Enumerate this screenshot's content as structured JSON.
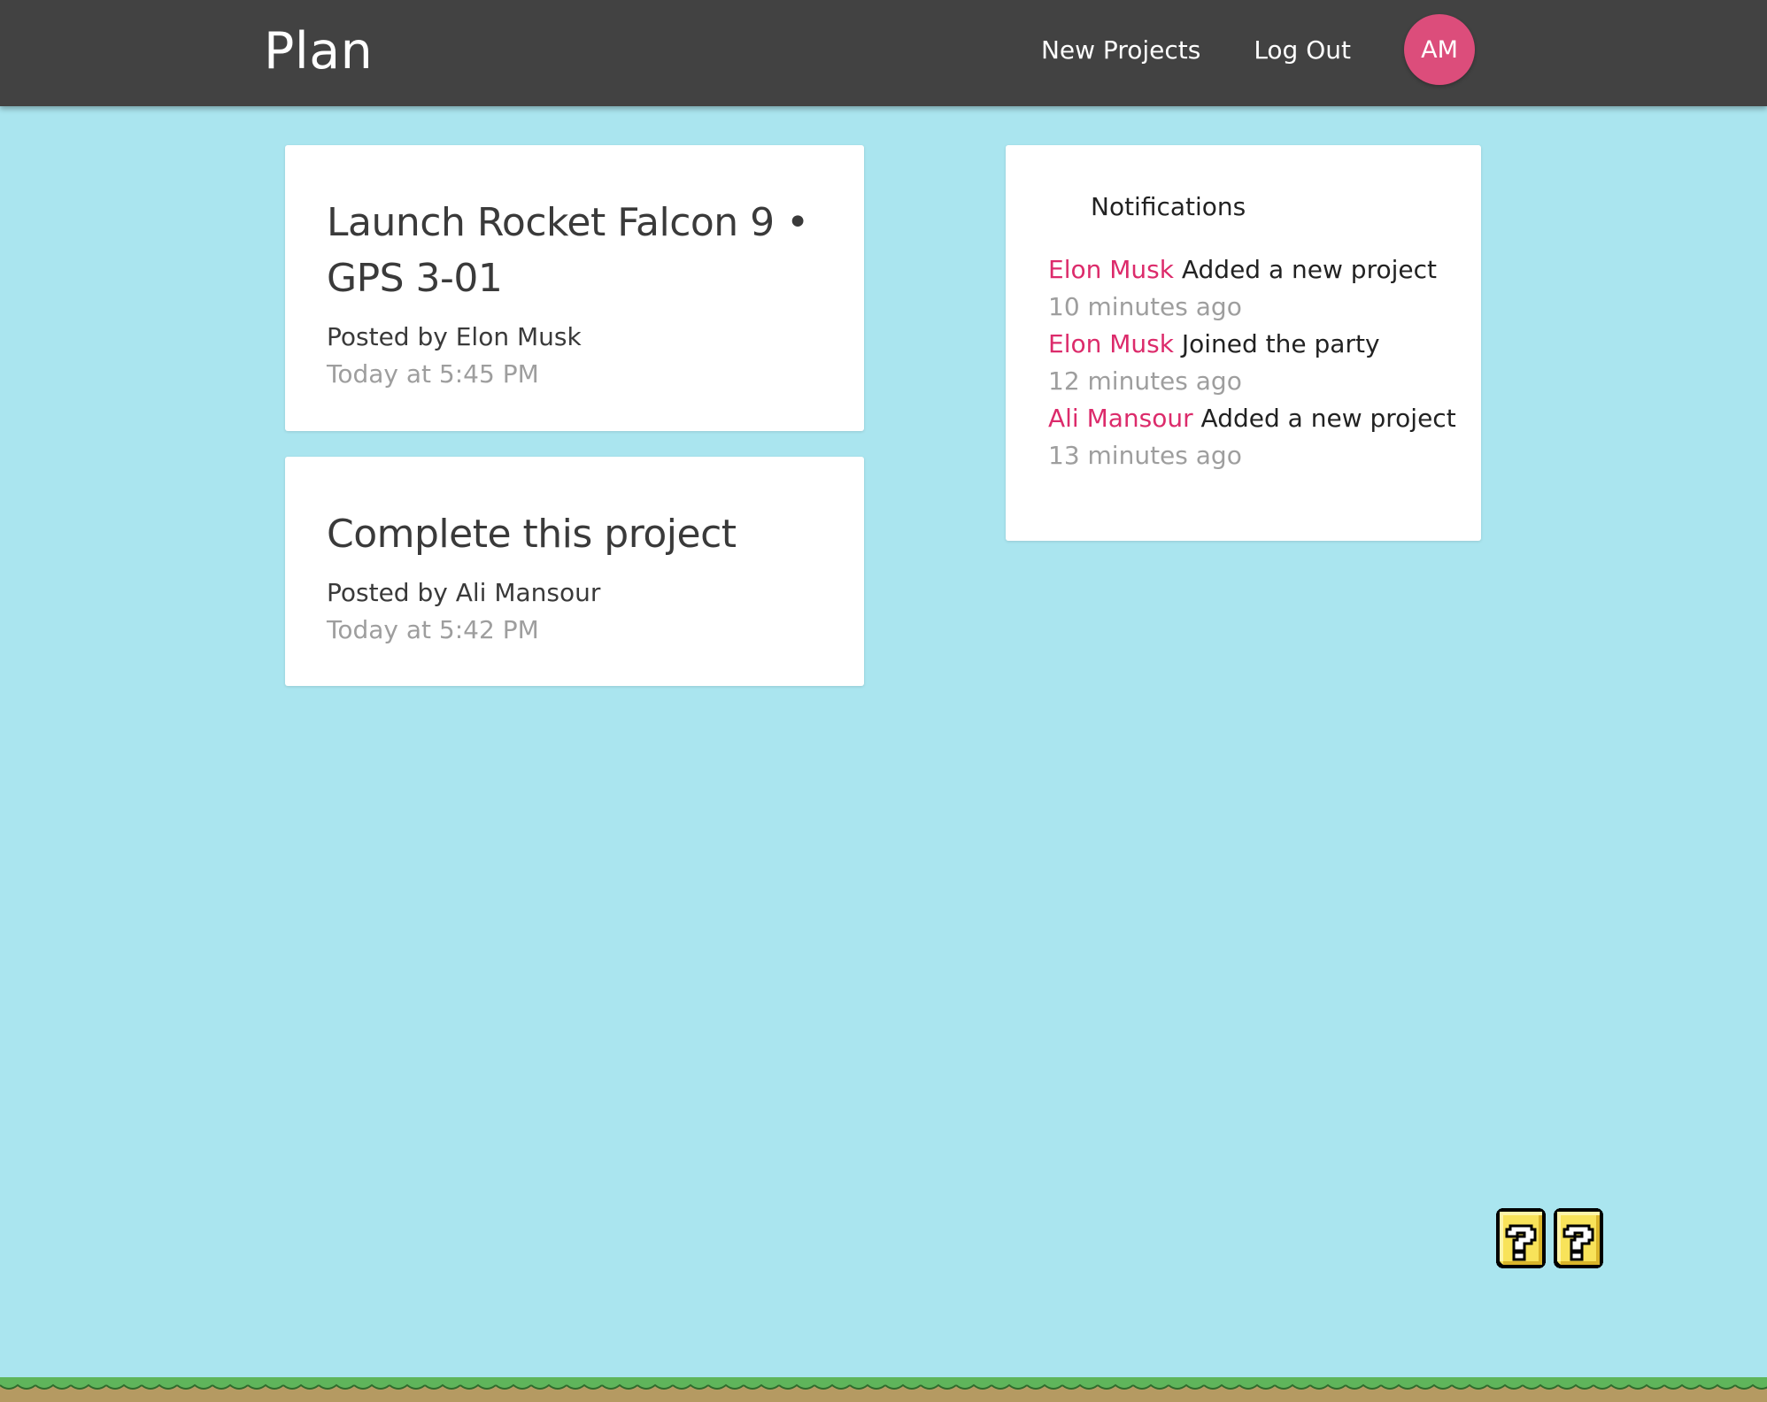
{
  "navbar": {
    "brand": "Plan",
    "links": [
      "New Projects",
      "Log Out"
    ],
    "avatar_initials": "AM",
    "background": "#424242",
    "avatar_color": "#dc4d7b"
  },
  "projects": [
    {
      "title": "Launch Rocket Falcon 9 • GPS 3-01",
      "author": "Posted by Elon Musk",
      "date": "Today at 5:45 PM"
    },
    {
      "title": "Complete this project",
      "author": "Posted by Ali Mansour",
      "date": "Today at 5:42 PM"
    }
  ],
  "notifications": {
    "title": "Notifications",
    "items": [
      {
        "user": "Elon Musk",
        "action": " Added a new project",
        "time": "10 minutes ago"
      },
      {
        "user": "Elon Musk",
        "action": " Joined the party",
        "time": "12 minutes ago"
      },
      {
        "user": "Ali Mansour",
        "action": " Added a new project",
        "time": "13 minutes ago"
      }
    ]
  },
  "decorations": {
    "question_blocks": [
      "question-block-icon",
      "question-block-icon"
    ],
    "ground": "grass-ground"
  },
  "colors": {
    "background": "#aae5ef",
    "accent": "#dc2b6b",
    "muted": "#9e9e9e"
  }
}
